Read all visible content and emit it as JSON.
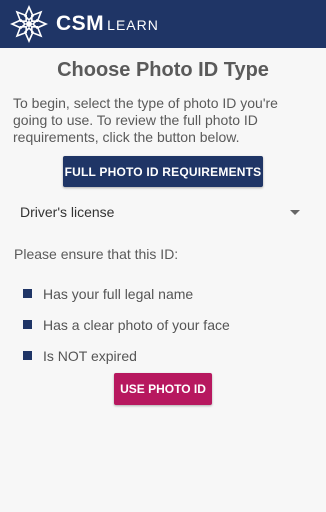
{
  "header": {
    "brand": "CSM",
    "brand_sub": "LEARN",
    "background_color": "#1f3566",
    "logo_icon": "star-logo-icon"
  },
  "title": "Choose Photo ID Type",
  "intro": "To begin, select the type of photo ID you're going to use. To review the full photo ID requirements, click the button below.",
  "requirements_button": {
    "label": "FULL PHOTO ID REQUIREMENTS",
    "color": "#1f3566"
  },
  "id_type_select": {
    "selected": "Driver's license",
    "icon": "caret-down-icon"
  },
  "ensure_text": "Please ensure that this ID:",
  "checklist": [
    "Has your full legal name",
    "Has a clear photo of your face",
    "Is NOT expired"
  ],
  "use_button": {
    "label": "USE PHOTO ID",
    "color": "#b7185f"
  }
}
